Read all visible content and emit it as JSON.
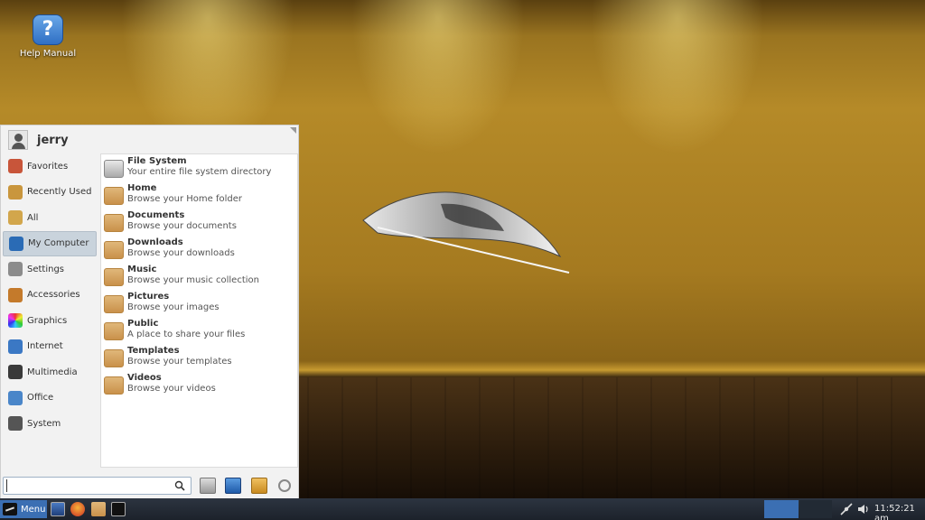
{
  "desktop": {
    "icons": [
      {
        "label": "Help Manual",
        "glyph": "?"
      }
    ]
  },
  "menu": {
    "username": "jerry",
    "categories": [
      {
        "label": "Favorites",
        "color": "#c8553a"
      },
      {
        "label": "Recently Used",
        "color": "#c9963d"
      },
      {
        "label": "All",
        "color": "#d2a64c"
      },
      {
        "label": "My Computer",
        "color": "#2a6bb5",
        "selected": true
      },
      {
        "label": "Settings",
        "color": "#8c8c8c"
      },
      {
        "label": "Accessories",
        "color": "#c47a2b"
      },
      {
        "label": "Graphics",
        "color": "#d64a8a"
      },
      {
        "label": "Internet",
        "color": "#3b78c4"
      },
      {
        "label": "Multimedia",
        "color": "#3a3a3a"
      },
      {
        "label": "Office",
        "color": "#4a86c9"
      },
      {
        "label": "System",
        "color": "#555555"
      }
    ],
    "places": [
      {
        "title": "File System",
        "desc": "Your entire file system directory"
      },
      {
        "title": "Home",
        "desc": "Browse your Home folder"
      },
      {
        "title": "Documents",
        "desc": "Browse your documents"
      },
      {
        "title": "Downloads",
        "desc": "Browse your downloads"
      },
      {
        "title": "Music",
        "desc": "Browse your music collection"
      },
      {
        "title": "Pictures",
        "desc": "Browse your images"
      },
      {
        "title": "Public",
        "desc": "A place to share your files"
      },
      {
        "title": "Templates",
        "desc": "Browse your templates"
      },
      {
        "title": "Videos",
        "desc": "Browse your videos"
      }
    ],
    "search": {
      "value": "",
      "placeholder": ""
    }
  },
  "taskbar": {
    "menu_label": "Menu",
    "clock": "11:52:21 am"
  }
}
